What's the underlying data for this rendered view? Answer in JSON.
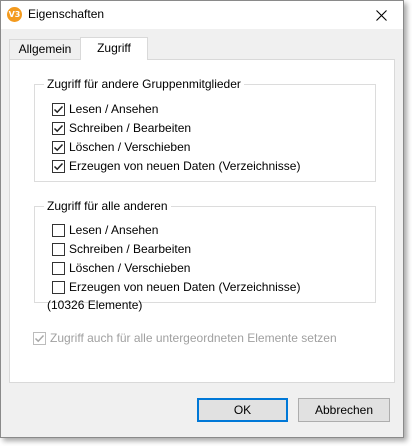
{
  "window": {
    "title": "Eigenschaften",
    "icon": "app-logo-icon",
    "icon_text": "V3"
  },
  "tabs": [
    {
      "label": "Allgemein",
      "active": false
    },
    {
      "label": "Zugriff",
      "active": true
    }
  ],
  "group_members": {
    "title": "Zugriff für andere Gruppenmitglieder",
    "items": [
      {
        "label": "Lesen / Ansehen",
        "checked": true
      },
      {
        "label": "Schreiben / Bearbeiten",
        "checked": true
      },
      {
        "label": "Löschen / Verschieben",
        "checked": true
      },
      {
        "label": "Erzeugen von neuen Daten (Verzeichnisse)",
        "checked": true
      }
    ]
  },
  "all_others": {
    "title": "Zugriff für alle anderen",
    "items": [
      {
        "label": "Lesen / Ansehen",
        "checked": false
      },
      {
        "label": "Schreiben / Bearbeiten",
        "checked": false
      },
      {
        "label": "Löschen / Verschieben",
        "checked": false
      },
      {
        "label": "Erzeugen von neuen Daten (Verzeichnisse)",
        "checked": false
      }
    ]
  },
  "subelements": {
    "label": "Zugriff auch für alle untergeordneten Elemente setzen",
    "checked": true,
    "disabled": true,
    "count_text": "(10326 Elemente)"
  },
  "buttons": {
    "ok": "OK",
    "cancel": "Abbrechen"
  },
  "colors": {
    "accent": "#0078d7",
    "logo": "#f39a1e",
    "dialog_bg": "#f0f0f0"
  }
}
